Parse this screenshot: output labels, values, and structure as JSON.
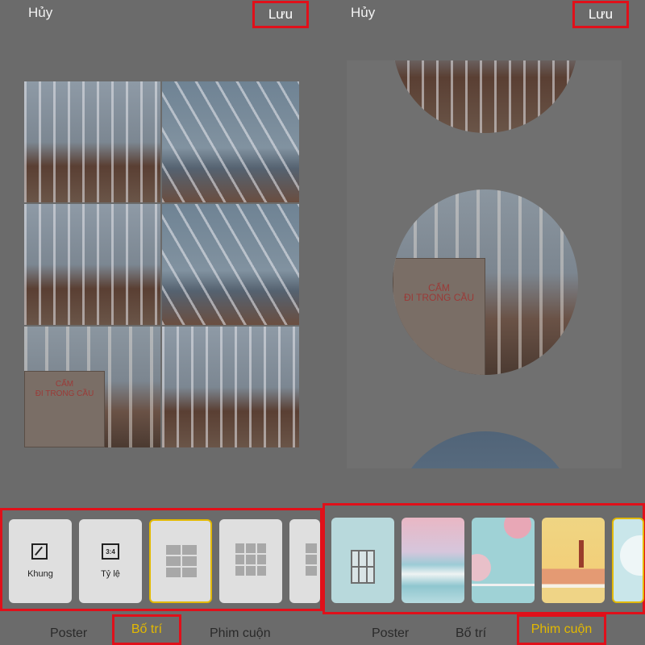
{
  "left": {
    "header": {
      "cancel": "Hủy",
      "save": "Lưu"
    },
    "tools": [
      {
        "label": "Khung",
        "icon": "frame-icon"
      },
      {
        "label": "Tỷ lệ",
        "icon": "ratio-icon",
        "icon_text": "3:4"
      }
    ],
    "sign_text": "CẤM\nĐI TRONG CẦU",
    "tabs": [
      "Poster",
      "Bố trí",
      "Phim cuộn"
    ],
    "active_tab": "Bố trí"
  },
  "right": {
    "header": {
      "cancel": "Hủy",
      "save": "Lưu"
    },
    "sign_text": "CẤM\nĐI TRONG CẦU",
    "tabs": [
      "Poster",
      "Bố trí",
      "Phim cuộn"
    ],
    "active_tab": "Phim cuộn"
  },
  "colors": {
    "highlight": "#e0101a",
    "accent": "#e3b900",
    "background": "#6b6b6b"
  }
}
